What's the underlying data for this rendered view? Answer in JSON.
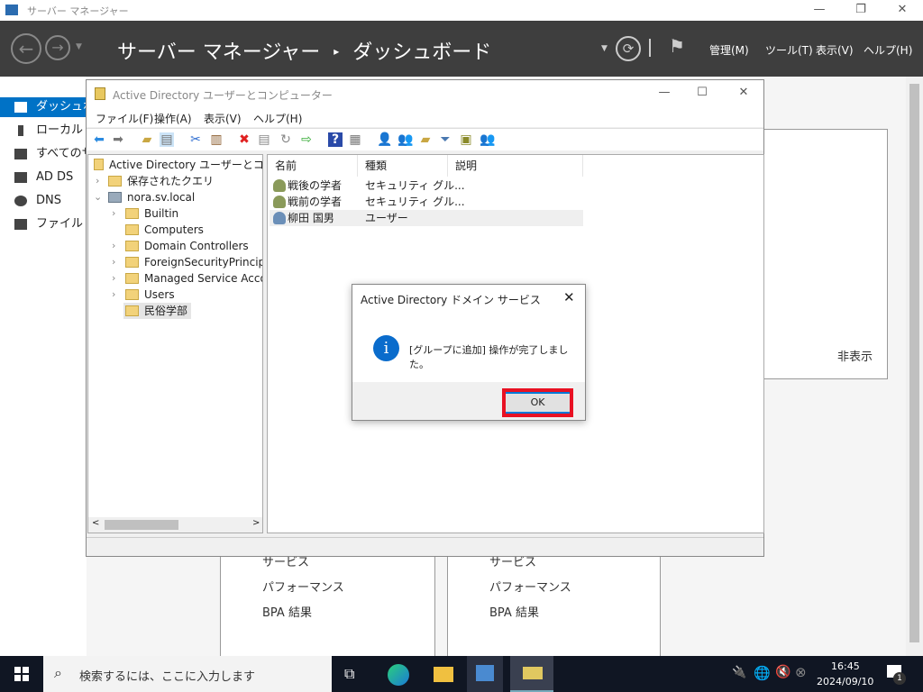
{
  "app": {
    "title": "サーバー マネージャー",
    "breadcrumb_root": "サーバー マネージャー",
    "breadcrumb_sep": "▸",
    "breadcrumb_page": "ダッシュボード",
    "menu": [
      "管理(M)",
      "ツール(T)",
      "表示(V)",
      "ヘルプ(H)"
    ]
  },
  "sidebar": {
    "items": [
      {
        "label": "ダッシュボード",
        "selected": true
      },
      {
        "label": "ローカル サーバー"
      },
      {
        "label": "すべてのサーバー"
      },
      {
        "label": "AD DS"
      },
      {
        "label": "DNS"
      },
      {
        "label": "ファイル サービス"
      }
    ]
  },
  "dashboard": {
    "hide_label": "非表示",
    "tiles": [
      {
        "items": [
          "サービス",
          "パフォーマンス",
          "BPA 結果"
        ]
      },
      {
        "items": [
          "サービス",
          "パフォーマンス",
          "BPA 結果"
        ]
      }
    ]
  },
  "aduc": {
    "title": "Active Directory ユーザーとコンピューター",
    "menu": [
      "ファイル(F)",
      "操作(A)",
      "表示(V)",
      "ヘルプ(H)"
    ],
    "tree": {
      "root": "Active Directory ユーザーとコンピューター",
      "saved": "保存されたクエリ",
      "domain": "nora.sv.local",
      "children": [
        "Builtin",
        "Computers",
        "Domain Controllers",
        "ForeignSecurityPrincipals",
        "Managed Service Accounts",
        "Users",
        "民俗学部"
      ],
      "selected": "民俗学部"
    },
    "columns": [
      "名前",
      "種類",
      "説明"
    ],
    "rows": [
      {
        "name": "戦後の学者",
        "type": "セキュリティ グル...",
        "icon": "group-icon"
      },
      {
        "name": "戦前の学者",
        "type": "セキュリティ グル...",
        "icon": "group-icon"
      },
      {
        "name": "柳田 国男",
        "type": "ユーザー",
        "icon": "user-icon"
      }
    ]
  },
  "dialog": {
    "title": "Active Directory ドメイン サービス",
    "message": "[グループに追加] 操作が完了しました。",
    "ok": "OK",
    "highlight_color": "#e81123"
  },
  "taskbar": {
    "search_placeholder": "検索するには、ここに入力します",
    "time": "16:45",
    "date": "2024/09/10",
    "notifications": "1"
  }
}
